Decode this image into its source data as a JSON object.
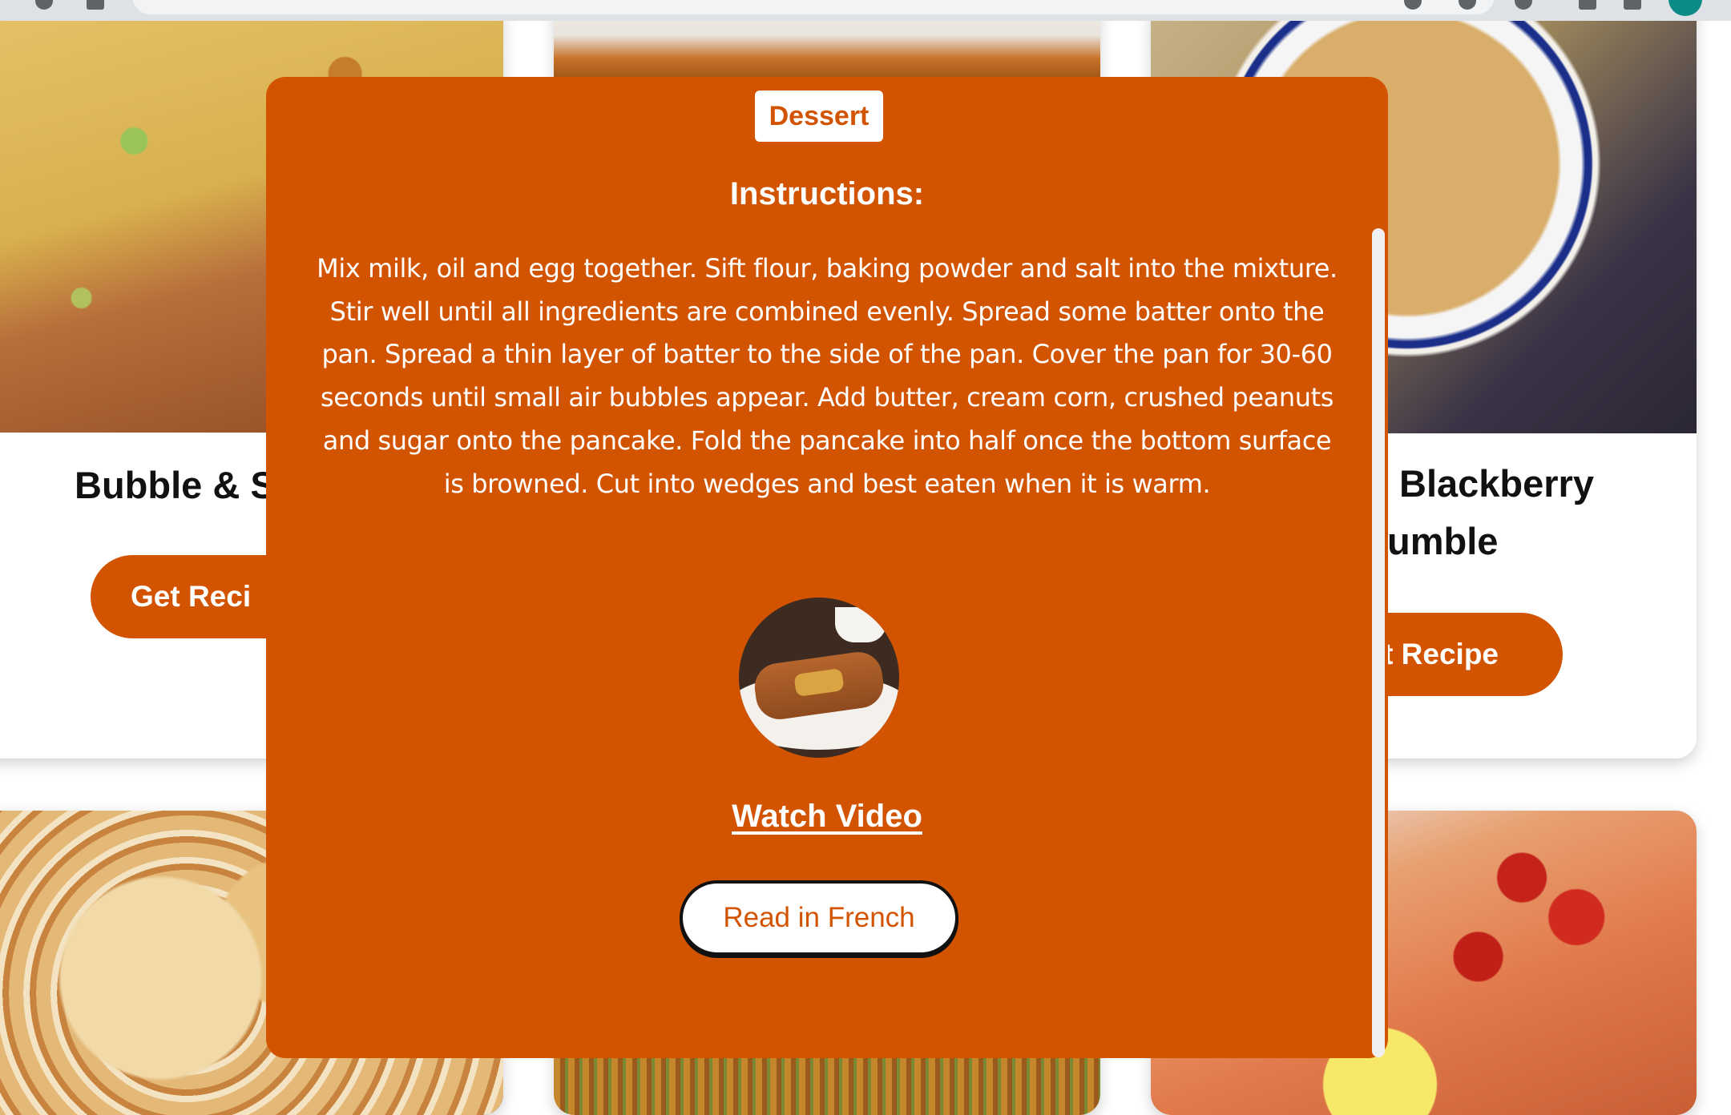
{
  "modal": {
    "category_tag": "Dessert",
    "heading": "Instructions:",
    "instructions": "Mix milk, oil and egg together. Sift flour, baking powder and salt into the mixture. Stir well until all ingredients are combined evenly. Spread some batter onto the pan. Spread a thin layer of batter to the side of the pan. Cover the pan for 30-60 seconds until small air bubbles appear. Add butter, cream corn, crushed peanuts and sugar onto the pancake. Fold the pancake into half once the bottom surface is browned. Cut into wedges and best eaten when it is warm.",
    "watch_video_label": "Watch Video",
    "read_french_label": "Read in French"
  },
  "background_cards": [
    {
      "title": "Bubble & S",
      "button_label": "Get Reci"
    },
    {
      "title_line1": "Blackberry",
      "title_line2": "umble",
      "button_label": "t Recipe"
    }
  ],
  "colors": {
    "accent": "#d35400",
    "modal_text": "#ffffff",
    "card_background": "#ffffff"
  },
  "icons": {
    "video_thumbnail": "pancake-video-thumbnail"
  }
}
